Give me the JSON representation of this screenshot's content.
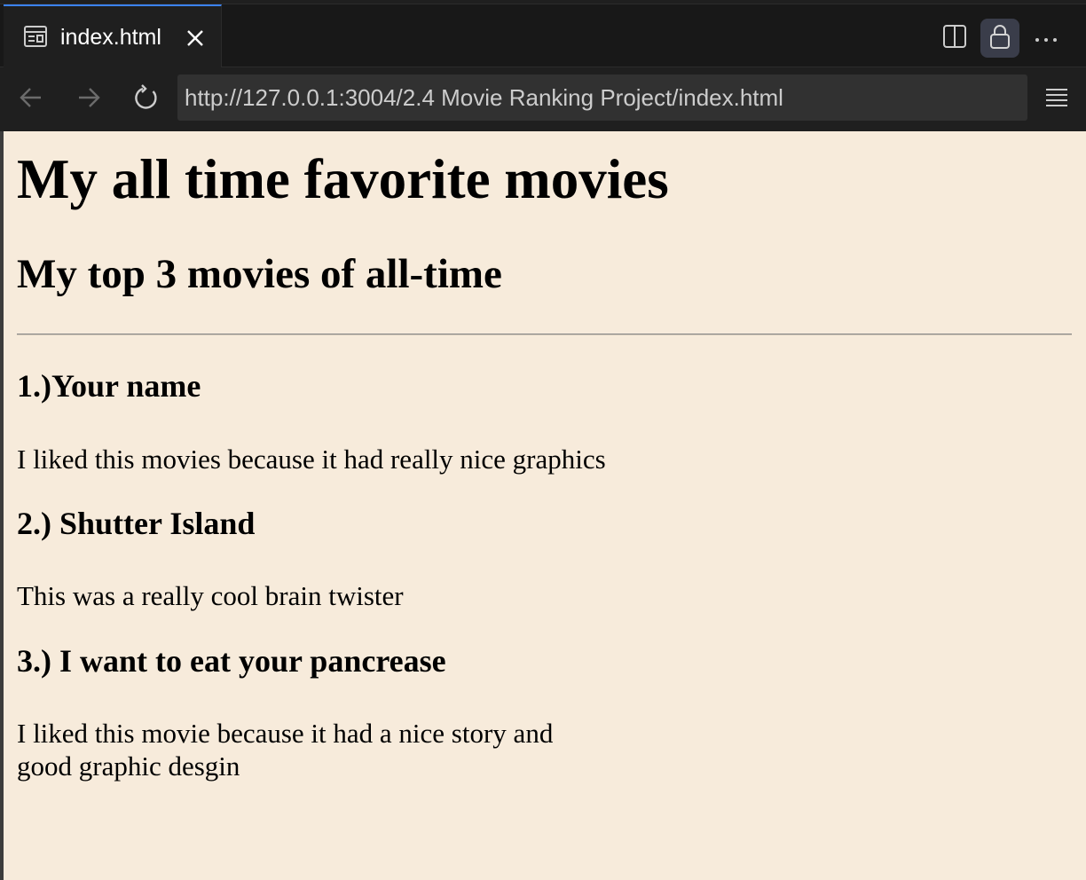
{
  "tab": {
    "title": "index.html",
    "icon": "preview-icon",
    "close_icon": "close-icon"
  },
  "toolbar": {
    "split_icon": "split-editor-icon",
    "lock_icon": "lock-icon",
    "more_icon": "more-actions-icon"
  },
  "navigation": {
    "back_icon": "arrow-left-icon",
    "forward_icon": "arrow-right-icon",
    "reload_icon": "reload-icon",
    "url": "http://127.0.0.1:3004/2.4 Movie Ranking Project/index.html",
    "menu_icon": "menu-icon"
  },
  "page": {
    "title": "My all time favorite movies",
    "subtitle": "My top 3 movies of all-time",
    "movies": [
      {
        "heading": "1.)Your name",
        "description": "I liked this movies because it had really nice graphics"
      },
      {
        "heading": "2.) Shutter Island",
        "description": "This was a really cool brain twister"
      },
      {
        "heading": "3.) I want to eat your pancrease",
        "description_line1": "I liked this movie because it had a nice story and",
        "description_line2": "good graphic desgin"
      }
    ]
  },
  "colors": {
    "page_background": "#f7ebdb",
    "chrome_background": "#1f1f1f",
    "tab_accent": "#3b82f6"
  }
}
